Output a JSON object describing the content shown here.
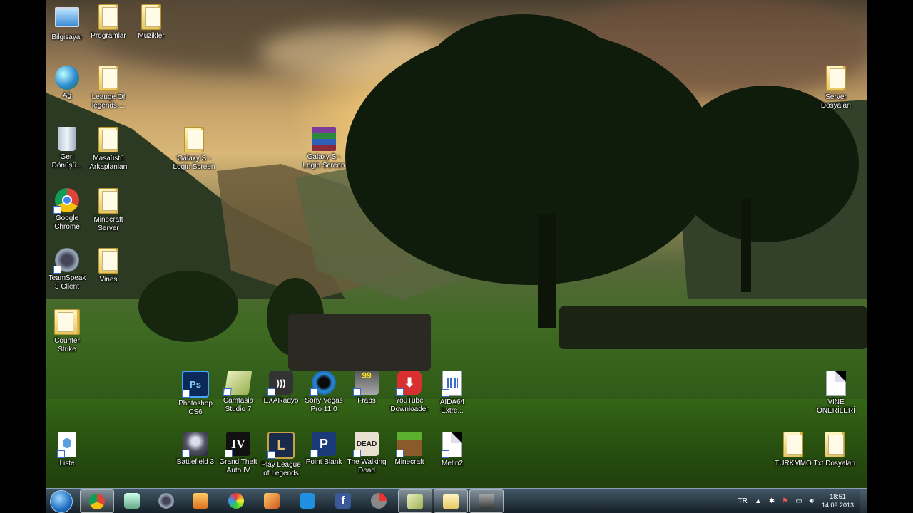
{
  "desktop_icons": {
    "bilgisayar": "Bilgisayar",
    "programlar": "Programlar",
    "muzikler": "Müzikler",
    "ag": "Ağ",
    "league_folder": "Leauge Of legends ...",
    "geri_donusum": "Geri Dönüşü...",
    "masaustu_arkaplan": "Masaüstü Arkaplanları",
    "galaxy_folder": "Galaxy S - Login Screen",
    "galaxy_rar": "Galaxy S - Login Screen",
    "chrome": "Google Chrome",
    "minecraft_server": "Minecraft Server",
    "teamspeak": "TeamSpeak 3 Client",
    "vines": "Vines",
    "counter_strike": "Counter Strike",
    "server_dosyalari": "Server Dosyaları",
    "photoshop": "Photoshop CS6",
    "camtasia": "Camtasia Studio 7",
    "exaradyo": "EXARadyo",
    "sony_vegas": "Sony Vegas Pro 11.0",
    "fraps": "Fraps",
    "youtube_downloader": "YouTube Downloader",
    "aida64": "AIDA64 Extre...",
    "vine_onerileri": "VİNE ÖNERİLERİ",
    "liste": "Liste",
    "battlefield": "Battlefield 3",
    "gta4": "Grand Theft Auto IV",
    "play_lol": "Play League of Legends",
    "point_blank": "Point Blank",
    "walking_dead": "The Walking Dead",
    "minecraft": "Minecraft",
    "metin2": "Metin2",
    "turkmmo": "TURKMMO",
    "txt_dosyalari": "Txt Dosyaları"
  },
  "icon_glyphs": {
    "photoshop": "Ps",
    "fraps": "99",
    "gta4": "IV",
    "lol": "L",
    "pointblank": "P",
    "walking_dead": "DEAD"
  },
  "taskbar": {
    "language": "TR",
    "time": "18:51",
    "date": "14.09.2013"
  },
  "colors": {
    "start_orb": "#1f6fc0",
    "taskbar": "#2a3a4a"
  }
}
